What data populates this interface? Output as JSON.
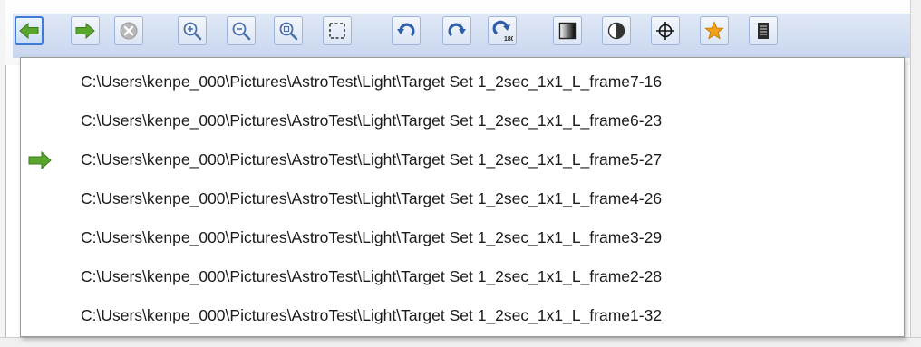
{
  "toolbar": {
    "buttons": [
      {
        "name": "back-button",
        "icon": "arrow-left-icon",
        "state": "active"
      },
      {
        "name": "forward-button",
        "icon": "arrow-right-icon",
        "state": "normal"
      },
      {
        "name": "stop-button",
        "icon": "stop-icon",
        "state": "disabled"
      },
      {
        "name": "zoom-in-button",
        "icon": "zoom-in-icon",
        "state": "normal"
      },
      {
        "name": "zoom-out-button",
        "icon": "zoom-out-icon",
        "state": "normal"
      },
      {
        "name": "zoom-fit-button",
        "icon": "zoom-fit-icon",
        "state": "normal"
      },
      {
        "name": "select-region-button",
        "icon": "select-region-icon",
        "state": "normal"
      },
      {
        "name": "rotate-left-button",
        "icon": "rotate-left-icon",
        "state": "normal"
      },
      {
        "name": "rotate-right-button",
        "icon": "rotate-right-icon",
        "state": "normal"
      },
      {
        "name": "rotate-180-button",
        "icon": "rotate-180-icon",
        "state": "normal",
        "label": "180"
      },
      {
        "name": "gradient-button",
        "icon": "gradient-icon",
        "state": "normal"
      },
      {
        "name": "contrast-button",
        "icon": "contrast-icon",
        "state": "normal"
      },
      {
        "name": "crosshair-button",
        "icon": "crosshair-icon",
        "state": "normal"
      },
      {
        "name": "star-button",
        "icon": "star-icon",
        "state": "normal"
      },
      {
        "name": "info-button",
        "icon": "document-list-icon",
        "state": "normal"
      }
    ]
  },
  "history": {
    "current_index": 2,
    "items": [
      "C:\\Users\\kenpe_000\\Pictures\\AstroTest\\Light\\Target Set 1_2sec_1x1_L_frame7-16",
      "C:\\Users\\kenpe_000\\Pictures\\AstroTest\\Light\\Target Set 1_2sec_1x1_L_frame6-23",
      "C:\\Users\\kenpe_000\\Pictures\\AstroTest\\Light\\Target Set 1_2sec_1x1_L_frame5-27",
      "C:\\Users\\kenpe_000\\Pictures\\AstroTest\\Light\\Target Set 1_2sec_1x1_L_frame4-26",
      "C:\\Users\\kenpe_000\\Pictures\\AstroTest\\Light\\Target Set 1_2sec_1x1_L_frame3-29",
      "C:\\Users\\kenpe_000\\Pictures\\AstroTest\\Light\\Target Set 1_2sec_1x1_L_frame2-28",
      "C:\\Users\\kenpe_000\\Pictures\\AstroTest\\Light\\Target Set 1_2sec_1x1_L_frame1-32"
    ],
    "current_marker_icon": "arrow-right-icon"
  },
  "colors": {
    "arrow_green": "#5aa52e",
    "toolbar_blue": "#c8d6ee",
    "rotate_blue": "#2f5ea8",
    "star_orange": "#f4a21a"
  }
}
